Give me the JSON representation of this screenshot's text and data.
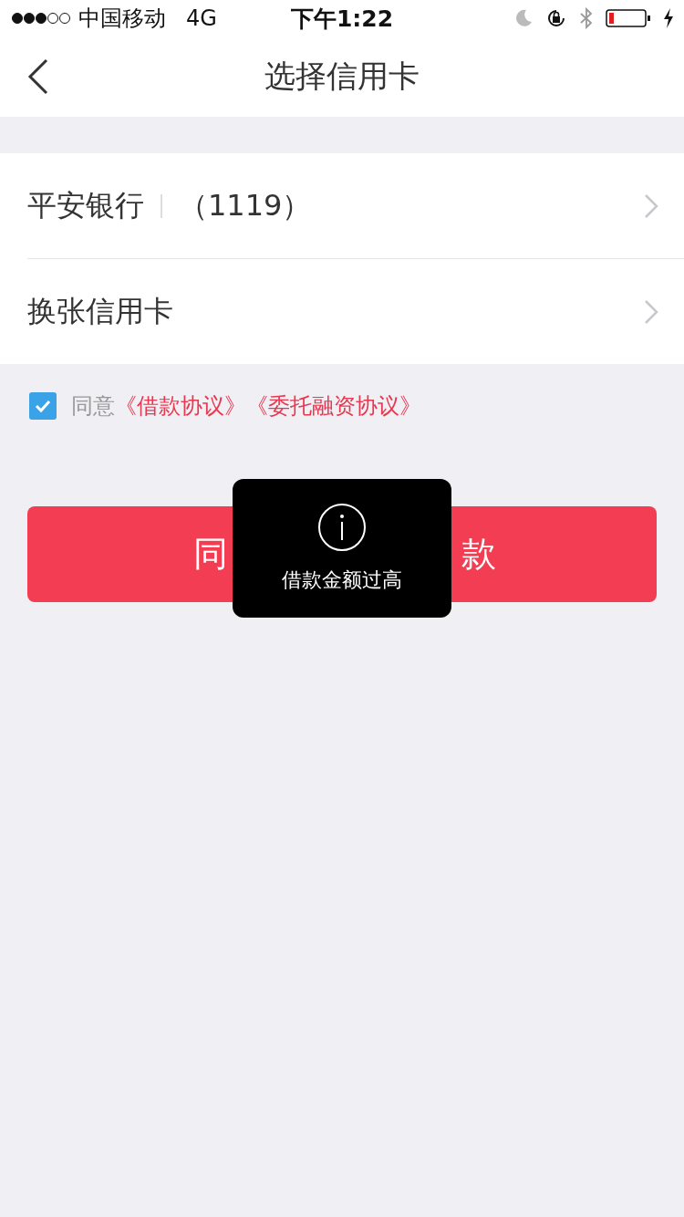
{
  "status_bar": {
    "carrier": "中国移动",
    "network": "4G",
    "time": "下午1:22"
  },
  "nav": {
    "title": "选择信用卡"
  },
  "cards": [
    {
      "kind": "bank",
      "name": "平安银行",
      "number": "（1119）"
    },
    {
      "kind": "action",
      "name": "换张信用卡"
    }
  ],
  "agreement": {
    "checked": true,
    "prefix": "同意",
    "links": [
      "《借款协议》",
      "《委托融资协议》"
    ]
  },
  "submit": {
    "label_start": "同",
    "label_end": "款"
  },
  "toast": {
    "message": "借款金额过高"
  }
}
